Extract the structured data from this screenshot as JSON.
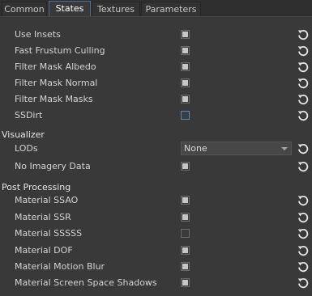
{
  "tabs": [
    {
      "label": "Common",
      "active": false
    },
    {
      "label": "States",
      "active": true
    },
    {
      "label": "Textures",
      "active": false
    },
    {
      "label": "Parameters",
      "active": false
    }
  ],
  "states": [
    {
      "label": "Use Insets",
      "checked": true
    },
    {
      "label": "Fast Frustum Culling",
      "checked": true
    },
    {
      "label": "Filter Mask Albedo",
      "checked": true
    },
    {
      "label": "Filter Mask Normal",
      "checked": true
    },
    {
      "label": "Filter Mask Masks",
      "checked": true
    },
    {
      "label": "SSDirt",
      "checked": false
    }
  ],
  "visualizer": {
    "title": "Visualizer",
    "lods_label": "LODs",
    "lods_value": "None",
    "no_imagery_label": "No Imagery Data",
    "no_imagery_checked": true
  },
  "post_processing": {
    "title": "Post Processing",
    "items": [
      {
        "label": "Material SSAO",
        "checked": true
      },
      {
        "label": "Material SSR",
        "checked": true
      },
      {
        "label": "Material SSSSS",
        "checked": false
      },
      {
        "label": "Material DOF",
        "checked": true
      },
      {
        "label": "Material Motion Blur",
        "checked": true
      },
      {
        "label": "Material Screen Space Shadows",
        "checked": true
      }
    ]
  },
  "icons": {
    "reset": "reset-icon"
  },
  "colors": {
    "accent": "#5b86b4",
    "background": "#393939"
  }
}
